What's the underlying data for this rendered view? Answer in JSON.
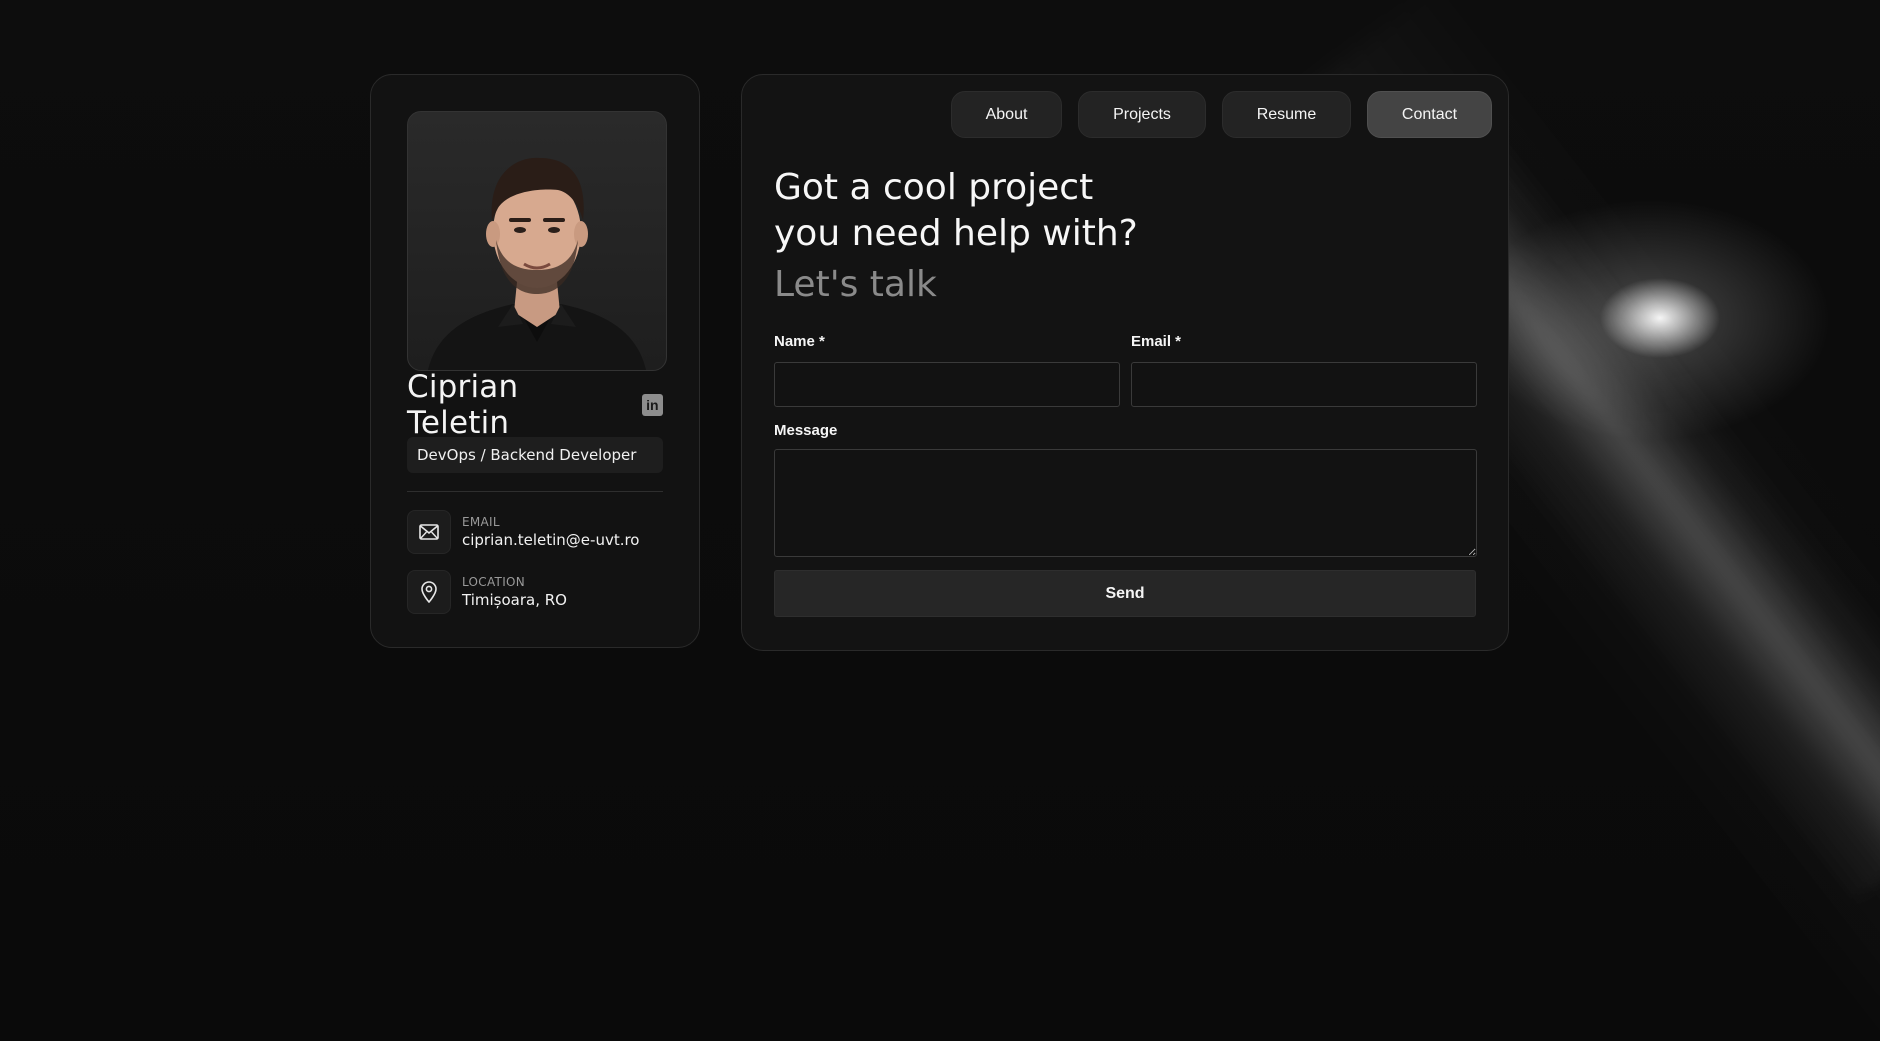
{
  "profile": {
    "name": "Ciprian Teletin",
    "linkedin_glyph": "in",
    "role": "DevOps / Backend Developer",
    "contacts": [
      {
        "icon": "mail-icon",
        "label": "EMAIL",
        "value": "ciprian.teletin@e-uvt.ro"
      },
      {
        "icon": "location-pin-icon",
        "label": "LOCATION",
        "value": "Timișoara, RO"
      }
    ]
  },
  "nav": {
    "items": [
      {
        "label": "About",
        "active": false
      },
      {
        "label": "Projects",
        "active": false
      },
      {
        "label": "Resume",
        "active": false
      },
      {
        "label": "Contact",
        "active": true
      }
    ]
  },
  "contact_page": {
    "heading_line1": "Got a cool project",
    "heading_line2": "you need help with?",
    "subheading": "Let's talk",
    "form": {
      "name_label": "Name *",
      "name_value": "",
      "email_label": "Email *",
      "email_value": "",
      "message_label": "Message",
      "message_value": "",
      "send_label": "Send"
    }
  },
  "colors": {
    "background": "#0b0b0b",
    "card": "#131313",
    "nav_active": "#444444",
    "nav_inactive": "#232323",
    "muted_text": "#8a8a8a"
  }
}
